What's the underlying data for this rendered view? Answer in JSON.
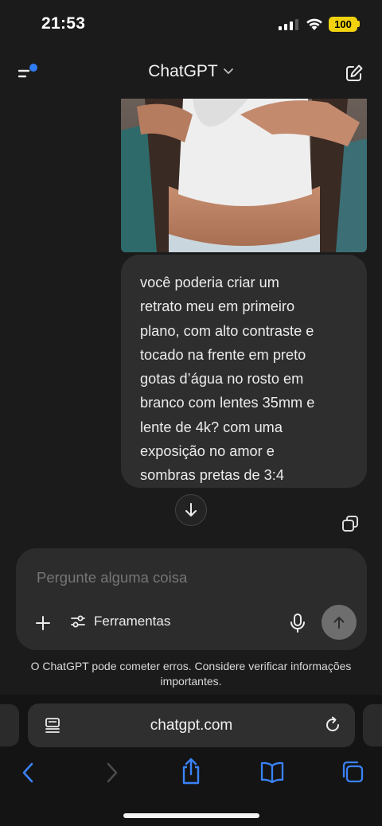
{
  "status_bar": {
    "time": "21:53",
    "battery": "100"
  },
  "header": {
    "title": "ChatGPT",
    "menu_icon": "sidebar-menu-icon",
    "edit_icon": "new-chat-icon"
  },
  "conversation": {
    "user_message": " você poderia criar um\nretrato meu em primeiro\nplano, com alto contraste e\ntocado na frente em preto\ngotas d’água no rosto em\nbranco com lentes 35mm e\nlente de 4k? com uma\nexposição no amor e\nsombras pretas de 3:4"
  },
  "composer": {
    "placeholder": "Pergunte alguma coisa",
    "tools_label": "Ferramentas"
  },
  "disclaimer": "O ChatGPT pode cometer erros. Considere verificar informações importantes.",
  "browser": {
    "url": "chatgpt.com"
  },
  "colors": {
    "background": "#1b1b1b",
    "bubble": "#2e2e2e",
    "battery": "#f2d20e",
    "ios_blue": "#3a82f7"
  }
}
